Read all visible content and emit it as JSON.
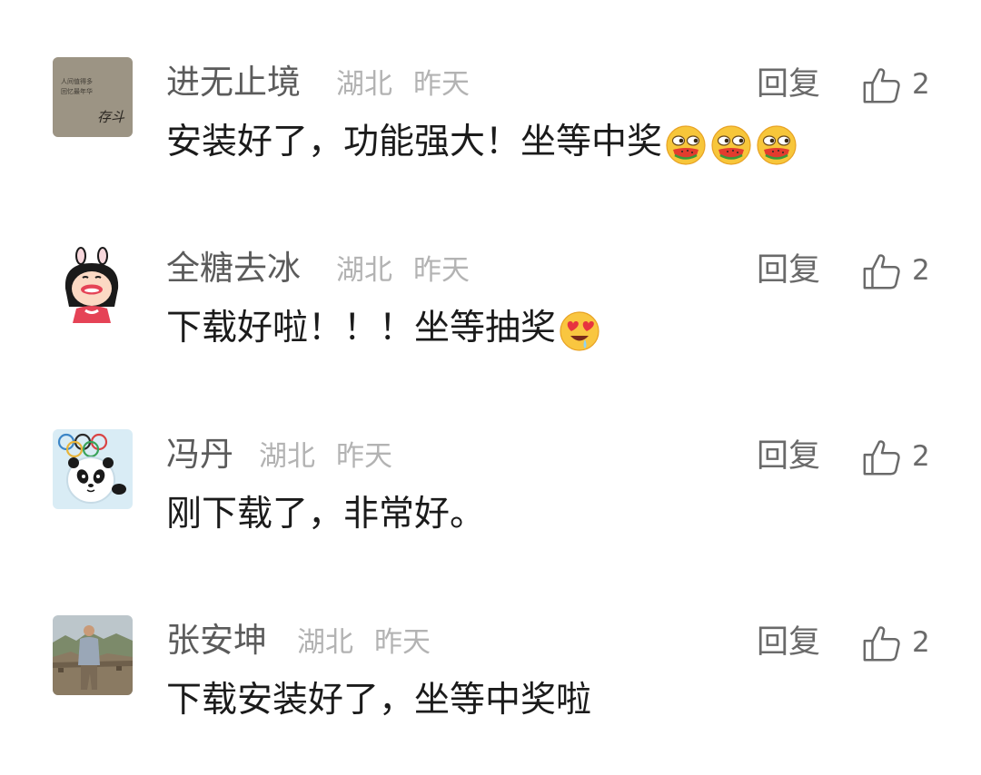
{
  "comments": [
    {
      "name": "进无止境",
      "location": "湖北",
      "time": "昨天",
      "reply_label": "回复",
      "likes": "2",
      "text": "安装好了，功能强大！坐等中奖",
      "emojis": [
        "watermelon-eating-emoji",
        "watermelon-eating-emoji",
        "watermelon-eating-emoji"
      ],
      "avatar": {
        "icon": "calligraphy-avatar",
        "text_lines": [
          "人间值得多",
          "回忆最年华"
        ],
        "signature": "存斗"
      }
    },
    {
      "name": "全糖去冰",
      "location": "湖北",
      "time": "昨天",
      "reply_label": "回复",
      "likes": "2",
      "text": "下载好啦！！！坐等抽奖",
      "emojis": [
        "heart-eyes-emoji"
      ],
      "avatar": {
        "icon": "cartoon-girl-avatar"
      }
    },
    {
      "name": "冯丹",
      "location": "湖北",
      "time": "昨天",
      "reply_label": "回复",
      "likes": "2",
      "text": "刚下载了，非常好。",
      "emojis": [],
      "avatar": {
        "icon": "panda-mascot-avatar"
      }
    },
    {
      "name": "张安坤",
      "location": "湖北",
      "time": "昨天",
      "reply_label": "回复",
      "likes": "2",
      "text": "下载安装好了，坐等中奖啦",
      "emojis": [],
      "avatar": {
        "icon": "great-wall-photo-avatar"
      }
    }
  ],
  "colors": {
    "name": "#5b5b5b",
    "meta": "#b3b3b3",
    "text": "#1b1b1b",
    "action": "#6a6a6a",
    "background": "#ffffff"
  }
}
